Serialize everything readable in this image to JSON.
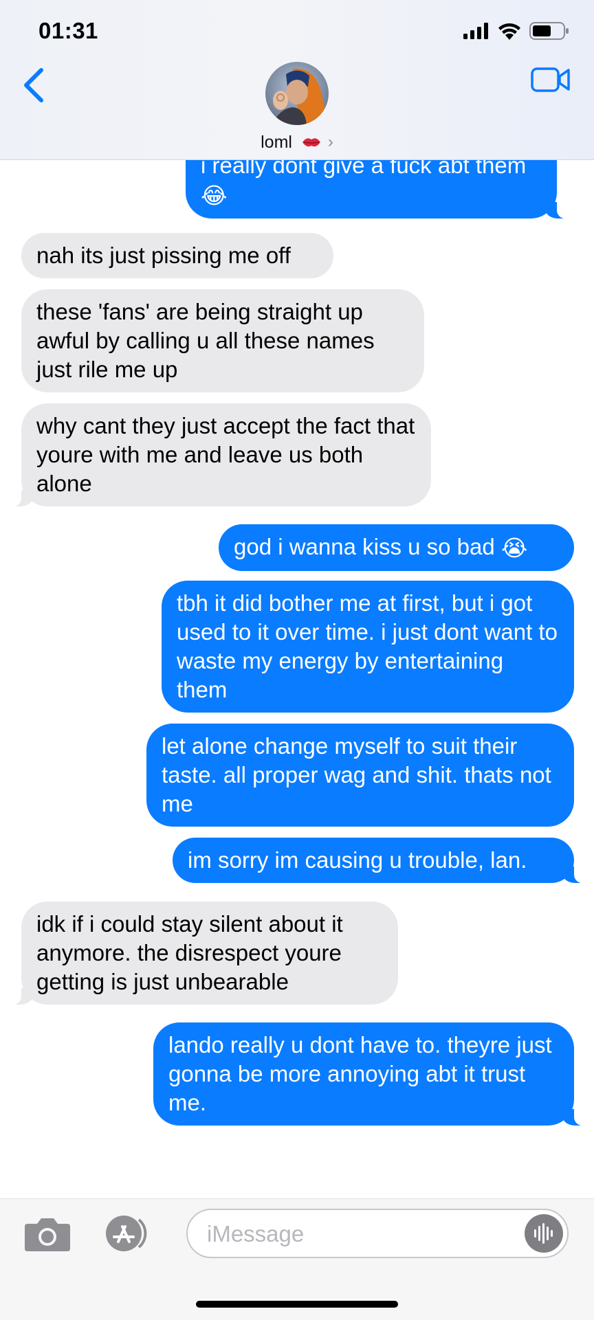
{
  "status_bar": {
    "time": "01:31"
  },
  "header": {
    "contact_name": "loml",
    "contact_emoji": "kiss-mark",
    "back_icon": "chevron-left-icon",
    "video_icon": "video-camera-icon"
  },
  "messages": [
    {
      "from": "me",
      "text": "i really dont give a fuck abt them",
      "emoji": "😂"
    },
    {
      "from": "them",
      "text": "nah its just pissing me off"
    },
    {
      "from": "them",
      "text": "these 'fans' are being straight up awful by calling u all these names just rile me up"
    },
    {
      "from": "them",
      "text": "why cant they just accept the fact that youre with me and leave us both alone"
    },
    {
      "from": "me",
      "text": "god i wanna kiss u so bad",
      "emoji": "😭"
    },
    {
      "from": "me",
      "text": "tbh it did bother me at first, but i got used to it over time. i just dont want to waste my energy by entertaining them"
    },
    {
      "from": "me",
      "text": "let alone change myself to suit their taste. all proper wag and shit. thats not me"
    },
    {
      "from": "me",
      "text": "im sorry im causing u trouble, lan."
    },
    {
      "from": "them",
      "text": "idk if i could stay silent about it anymore. the disrespect youre getting is just unbearable"
    },
    {
      "from": "me",
      "text": "lando really u dont have to. theyre just gonna be more annoying abt it trust me."
    }
  ],
  "composer": {
    "placeholder": "iMessage"
  },
  "colors": {
    "outgoing": "#0a7cff",
    "incoming": "#e9e9eb",
    "accent": "#0a7cff"
  }
}
